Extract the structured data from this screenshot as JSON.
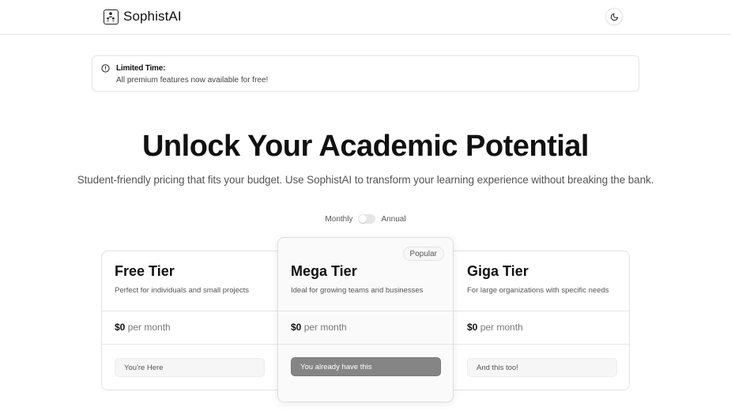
{
  "header": {
    "brand": "SophistAI",
    "logo_icon": "people-hierarchy-icon",
    "theme_icon": "moon-icon"
  },
  "alert": {
    "icon": "clock-icon",
    "title": "Limited Time:",
    "description": "All premium features now available for free!"
  },
  "hero": {
    "title": "Unlock Your Academic Potential",
    "subtitle": "Student-friendly pricing that fits your budget. Use SophistAI to transform your learning experience without breaking the bank."
  },
  "billing": {
    "monthly_label": "Monthly",
    "annual_label": "Annual",
    "selected": "Monthly"
  },
  "tiers": [
    {
      "name": "Free Tier",
      "description": "Perfect for individuals and small projects",
      "price": "$0",
      "period": "per month",
      "button": "You're Here"
    },
    {
      "name": "Mega Tier",
      "badge": "Popular",
      "description": "Ideal for growing teams and businesses",
      "price": "$0",
      "period": "per month",
      "button": "You already have this"
    },
    {
      "name": "Giga Tier",
      "description": "For large organizations with specific needs",
      "price": "$0",
      "period": "per month",
      "button": "And this too!"
    }
  ]
}
